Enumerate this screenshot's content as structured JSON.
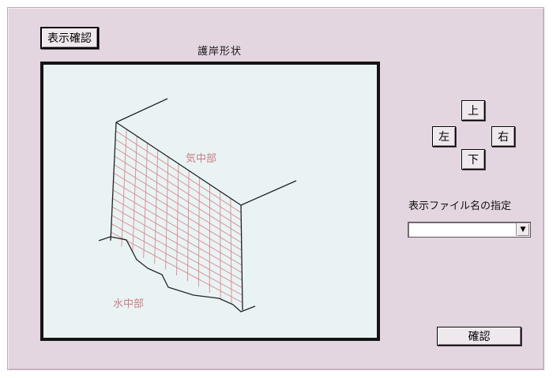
{
  "toolbar": {
    "display_check_label": "表示確認"
  },
  "main": {
    "title": "護岸形状",
    "labels": {
      "air_section": "気中部",
      "water_section": "水中部"
    }
  },
  "navigation": {
    "up": "上",
    "left": "左",
    "right": "右",
    "down": "下"
  },
  "file_select": {
    "label": "表示ファイル名の指定",
    "value": ""
  },
  "footer": {
    "confirm_label": "確認"
  },
  "icons": {
    "dropdown": "chevron-down-icon"
  }
}
